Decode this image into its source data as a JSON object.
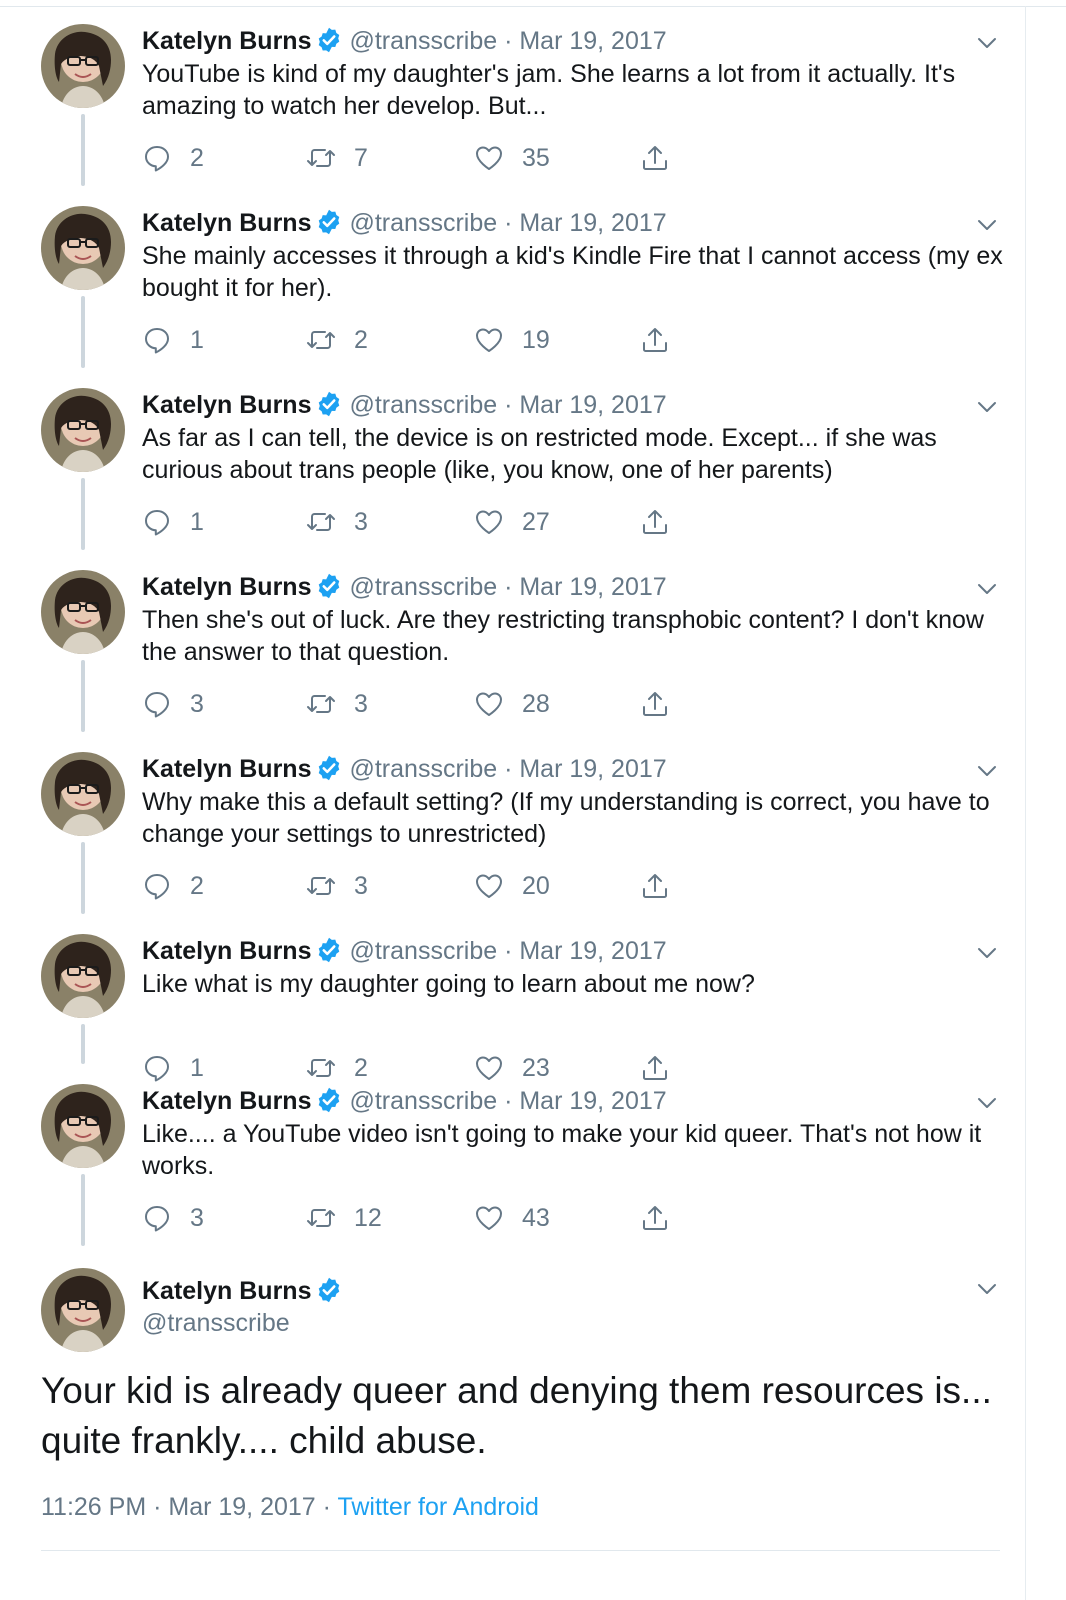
{
  "author": {
    "name": "Katelyn Burns",
    "handle": "@transscribe"
  },
  "colors": {
    "accent": "#1da1f2",
    "muted": "#657786",
    "text": "#14171a"
  },
  "thread": [
    {
      "date": "Mar 19, 2017",
      "text": "YouTube is kind of my daughter's jam. She learns a lot from it actually. It's amazing to watch her develop. But...",
      "replies": "2",
      "retweets": "7",
      "likes": "35"
    },
    {
      "date": "Mar 19, 2017",
      "text": "She mainly accesses it through a kid's Kindle Fire that I cannot access (my ex bought it for her).",
      "replies": "1",
      "retweets": "2",
      "likes": "19"
    },
    {
      "date": "Mar 19, 2017",
      "text": "As far as I can tell, the device is on restricted mode. Except... if she was curious about trans people (like, you know, one of her parents)",
      "replies": "1",
      "retweets": "3",
      "likes": "27"
    },
    {
      "date": "Mar 19, 2017",
      "text": "Then she's out of luck. Are they restricting transphobic content? I don't know the answer to that question.",
      "replies": "3",
      "retweets": "3",
      "likes": "28"
    },
    {
      "date": "Mar 19, 2017",
      "text": "Why make this a default setting? (If my understanding is correct, you have to change your settings to unrestricted)",
      "replies": "2",
      "retweets": "3",
      "likes": "20"
    },
    {
      "date": "Mar 19, 2017",
      "text": "Like what is my daughter going to learn about me now?",
      "replies": "1",
      "retweets": "2",
      "likes": "23"
    },
    {
      "date": "Mar 19, 2017",
      "text": "Like.... a YouTube video isn't going to make your kid queer. That's not how it works.",
      "replies": "3",
      "retweets": "12",
      "likes": "43"
    }
  ],
  "main_tweet": {
    "text": "Your kid is already queer and denying them resources is... quite frankly.... child abuse.",
    "time": "11:26 PM",
    "date": "Mar 19, 2017",
    "client": "Twitter for Android"
  },
  "icons": {
    "reply": "reply-icon",
    "retweet": "retweet-icon",
    "like": "heart-icon",
    "share": "share-icon",
    "verified": "verified-badge-icon",
    "menu": "chevron-down-icon"
  }
}
